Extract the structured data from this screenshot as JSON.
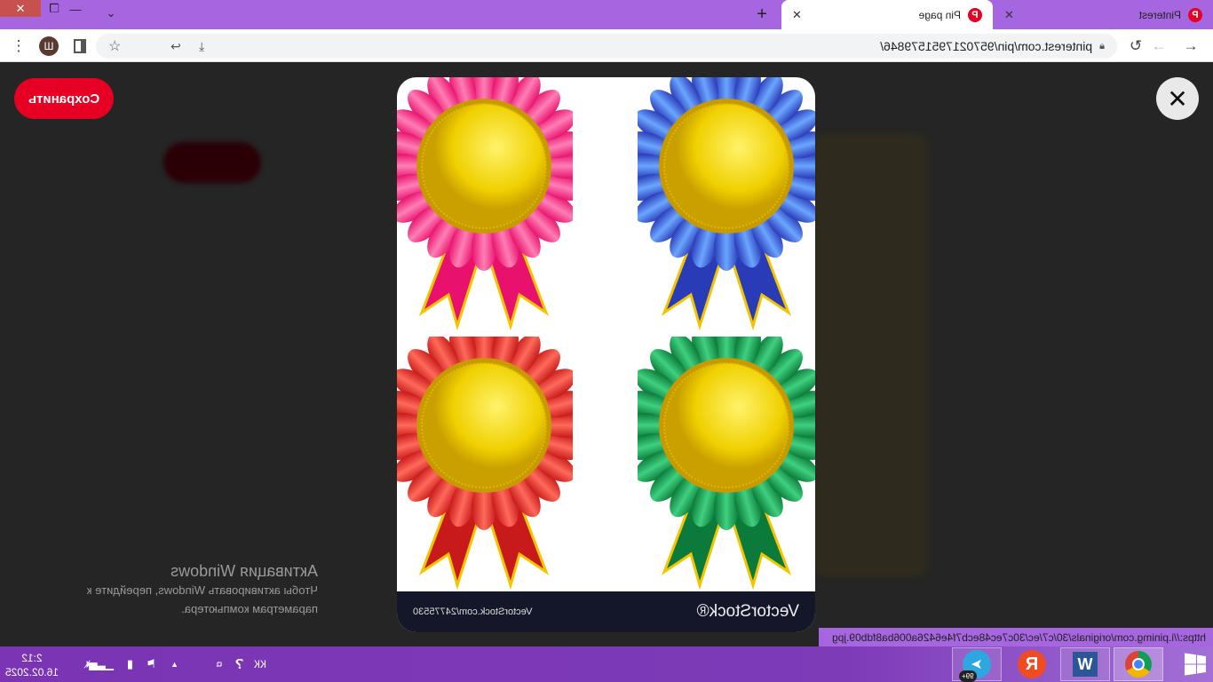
{
  "browser": {
    "tabs": [
      {
        "label": "Pinterest",
        "active": false
      },
      {
        "label": "Pin page",
        "active": true
      }
    ],
    "new_tab": "+",
    "address": "pinterest.com/pin/9570217951579846/"
  },
  "profile_initial": "Ш",
  "page": {
    "save_label": "Сохранить",
    "close_label": "✕",
    "image": {
      "watermark_logo": "VectorStock®",
      "watermark_url": "VectorStock.com/24775530",
      "medals": [
        {
          "name": "pink",
          "c1": "#e8126e",
          "c2": "#ff7fb5"
        },
        {
          "name": "blue",
          "c1": "#2a3bb8",
          "c2": "#6aa6ff"
        },
        {
          "name": "red",
          "c1": "#c81a1a",
          "c2": "#ff6a5a"
        },
        {
          "name": "green",
          "c1": "#0b7a3a",
          "c2": "#3fd080"
        }
      ]
    }
  },
  "activation": {
    "title": "Активация Windows",
    "line1": "Чтобы активировать Windows, перейдите к",
    "line2": "параметрам компьютера."
  },
  "status_url": "https://i.pinimg.com/originals/30/c7/ec/30c7ec48ecb7f4e6426a006ba8fdb09.jpg",
  "taskbar": {
    "lang": "КК",
    "time": "2:12",
    "date": "16.02.2025",
    "telegram_badge": "99+"
  },
  "colors": {
    "accent": "#e60023",
    "tabbar": "#a666e0"
  }
}
